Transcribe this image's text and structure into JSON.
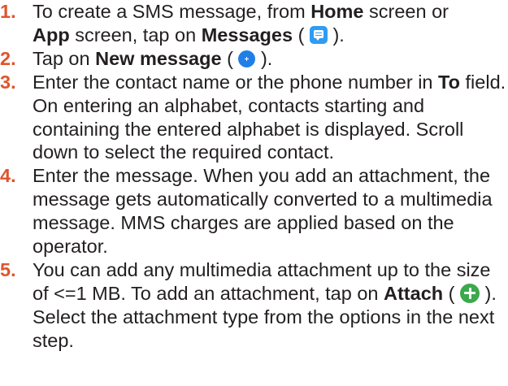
{
  "steps": [
    {
      "number": "1.",
      "t1": "To create a SMS message, from ",
      "b1": "Home",
      "t2": " screen or ",
      "b2": "App",
      "t3": " screen, tap on ",
      "b3": "Messages",
      "t4": " (",
      "t5": ")."
    },
    {
      "number": "2.",
      "t1": "Tap on ",
      "b1": "New message",
      "t2": " (",
      "t3": ")."
    },
    {
      "number": "3.",
      "t1": "Enter the contact name or the phone number in ",
      "b1": "To",
      "t2": " field. On entering an alphabet, contacts starting and containing the entered alphabet is displayed. Scroll down to select the required contact."
    },
    {
      "number": "4.",
      "t1": "Enter the message. When you add an attachment, the message gets automatically converted to a multimedia message. MMS charges are applied based on the operator."
    },
    {
      "number": "5.",
      "t1": "You can add any multimedia attachment up to the size of <=1 MB. To add an attachment, tap on ",
      "b1": "Attach",
      "t2": " (",
      "t3": "). Select the attachment type from the options in the next step."
    }
  ],
  "icons": {
    "messages": "messages-app-icon",
    "new_message": "new-message-plus-icon",
    "attach": "attach-plus-icon"
  },
  "colors": {
    "step_number": "#e0542c",
    "body_text": "#231f20",
    "messages_icon": "#2e9cf3",
    "new_message_icon": "#1f7fe8",
    "attach_icon": "#3ba94c"
  }
}
